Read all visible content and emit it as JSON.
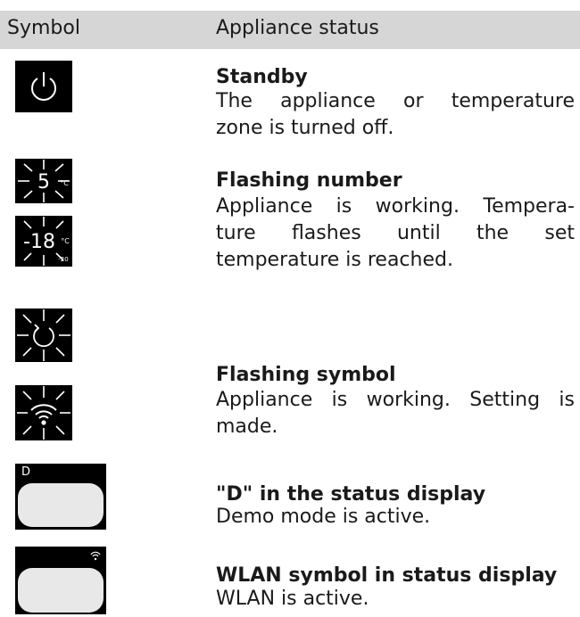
{
  "table": {
    "col_symbol": "Symbol",
    "col_status": "Appliance status"
  },
  "rows": [
    {
      "icons": [
        "power-icon"
      ],
      "title": "Standby",
      "desc_lines": [
        "The appliance or temperature",
        "zone is turned off."
      ]
    },
    {
      "icons": [
        "flashing-5-celsius-icon",
        "flashing-minus-18-celsius-icon"
      ],
      "icon_texts": {
        "five": "5",
        "five_unit": "°C",
        "minus18": "-18",
        "minus18_unit": "°C",
        "minus18_small": "-20"
      },
      "title": "Flashing number",
      "desc_lines": [
        "Appliance is working. Tempera-",
        "ture flashes until the set",
        "temperature is reached."
      ]
    },
    {
      "icons": [
        "flashing-refresh-icon",
        "flashing-wifi-icon"
      ],
      "title": "Flashing symbol",
      "desc_lines": [
        "Appliance is working. Setting is",
        "made."
      ]
    },
    {
      "icons": [
        "demo-status-display-icon"
      ],
      "icon_texts": {
        "badge": "D"
      },
      "title": "\"D\" in the status display",
      "desc_lines": [
        "Demo mode is active."
      ]
    },
    {
      "icons": [
        "wlan-status-display-icon"
      ],
      "title": "WLAN symbol in status display",
      "desc_lines": [
        "WLAN is active."
      ]
    }
  ],
  "colors": {
    "header_bg": "#d6d6d6",
    "tile_bg": "#000000",
    "panel_fill": "#e8e8e8",
    "text": "#1a1a1a"
  }
}
